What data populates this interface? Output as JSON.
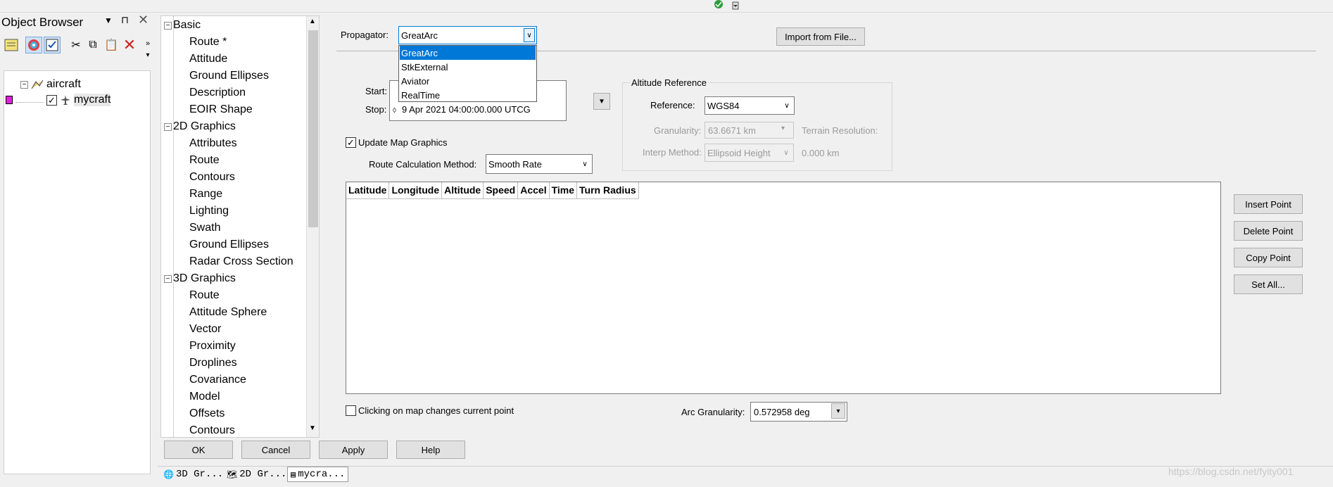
{
  "object_browser": {
    "title": "Object Browser",
    "tree": [
      {
        "label": "aircraft"
      },
      {
        "label": "mycraft"
      }
    ]
  },
  "page_tree": {
    "categories": [
      {
        "label": "Basic",
        "items": [
          "Route *",
          "Attitude",
          "Ground Ellipses",
          "Description",
          "EOIR Shape"
        ]
      },
      {
        "label": "2D Graphics",
        "items": [
          "Attributes",
          "Route",
          "Contours",
          "Range",
          "Lighting",
          "Swath",
          "Ground Ellipses",
          "Radar Cross Section"
        ]
      },
      {
        "label": "3D Graphics",
        "items": [
          "Route",
          "Attitude Sphere",
          "Vector",
          "Proximity",
          "Droplines",
          "Covariance",
          "Model",
          "Offsets",
          "Contours"
        ]
      }
    ]
  },
  "propagator": {
    "label": "Propagator:",
    "value": "GreatArc",
    "options": [
      "GreatArc",
      "StkExternal",
      "Aviator",
      "RealTime"
    ]
  },
  "import_button": "Import from File...",
  "start_label": "Start:",
  "stop_label": "Stop:",
  "stop_value": "9 Apr 2021 04:00:00.000 UTCG",
  "altitude_ref": {
    "title": "Altitude Reference",
    "reference_label": "Reference:",
    "reference_value": "WGS84",
    "granularity_label": "Granularity:",
    "granularity_value": "63.6671 km",
    "terrain_label": "Terrain Resolution:",
    "interp_label": "Interp Method:",
    "interp_value": "Ellipsoid Height",
    "interp_extra": "0.000 km"
  },
  "update_map": {
    "label": "Update Map Graphics",
    "checked": true
  },
  "route_calc": {
    "label": "Route Calculation Method:",
    "value": "Smooth Rate"
  },
  "grid_columns": [
    "Latitude",
    "Longitude",
    "Altitude",
    "Speed",
    "Accel",
    "Time",
    "Turn Radius"
  ],
  "side_buttons": [
    "Insert Point",
    "Delete Point",
    "Copy Point",
    "Set All..."
  ],
  "clicking_map": {
    "label": "Clicking on map changes current point",
    "checked": false
  },
  "arc_granularity": {
    "label": "Arc Granularity:",
    "value": "0.572958 deg"
  },
  "dialog_buttons": [
    "OK",
    "Cancel",
    "Apply",
    "Help"
  ],
  "tabs": [
    "3D Gr...",
    "2D Gr...",
    "mycra..."
  ],
  "watermark": "https://blog.csdn.net/fyity001"
}
